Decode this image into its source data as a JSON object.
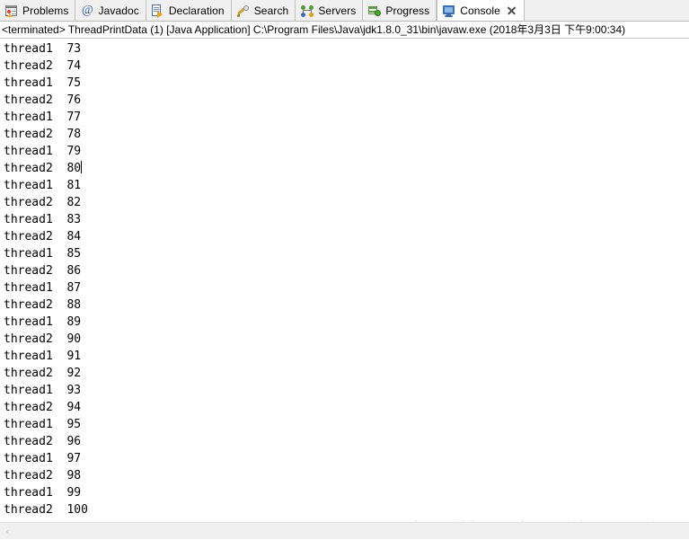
{
  "window": {
    "title": "Eclipse Console View"
  },
  "tabs": [
    {
      "id": "problems",
      "label": "Problems",
      "icon": "problems-icon",
      "active": false,
      "closable": false
    },
    {
      "id": "javadoc",
      "label": "Javadoc",
      "icon": "javadoc-icon",
      "active": false,
      "closable": false
    },
    {
      "id": "declaration",
      "label": "Declaration",
      "icon": "declaration-icon",
      "active": false,
      "closable": false
    },
    {
      "id": "search",
      "label": "Search",
      "icon": "search-icon",
      "active": false,
      "closable": false
    },
    {
      "id": "servers",
      "label": "Servers",
      "icon": "servers-icon",
      "active": false,
      "closable": false
    },
    {
      "id": "progress",
      "label": "Progress",
      "icon": "progress-icon",
      "active": false,
      "closable": false
    },
    {
      "id": "console",
      "label": "Console",
      "icon": "console-icon",
      "active": true,
      "closable": true
    }
  ],
  "process_header": {
    "status": "<terminated>",
    "launch_name": "ThreadPrintData (1)",
    "launch_type": "[Java Application]",
    "executable": "C:\\Program Files\\Java\\jdk1.8.0_31\\bin\\javaw.exe",
    "timestamp": "(2018年3月3日 下午9:00:34)",
    "full_text": "<terminated> ThreadPrintData (1) [Java Application] C:\\Program Files\\Java\\jdk1.8.0_31\\bin\\javaw.exe (2018年3月3日 下午9:00:34)"
  },
  "console": {
    "caret_after_line_index": 7,
    "lines": [
      "thread1  73",
      "thread2  74",
      "thread1  75",
      "thread2  76",
      "thread1  77",
      "thread2  78",
      "thread1  79",
      "thread2  80",
      "thread1  81",
      "thread2  82",
      "thread1  83",
      "thread2  84",
      "thread1  85",
      "thread2  86",
      "thread1  87",
      "thread2  88",
      "thread1  89",
      "thread2  90",
      "thread1  91",
      "thread2  92",
      "thread1  93",
      "thread2  94",
      "thread1  95",
      "thread2  96",
      "thread1  97",
      "thread2  98",
      "thread1  99",
      "thread2  100"
    ]
  },
  "watermark": {
    "text": "http://blog.csdn.net/xiongyouqiang"
  },
  "scrollbar": {
    "left_arrow": "‹"
  },
  "colors": {
    "tabbar_bg": "#f0f0f0",
    "active_tab_bg": "#ffffff",
    "console_bg": "#ffffff",
    "text": "#000000",
    "watermark": "#ebebeb",
    "scrollbar_bg": "#f0f0f0"
  }
}
